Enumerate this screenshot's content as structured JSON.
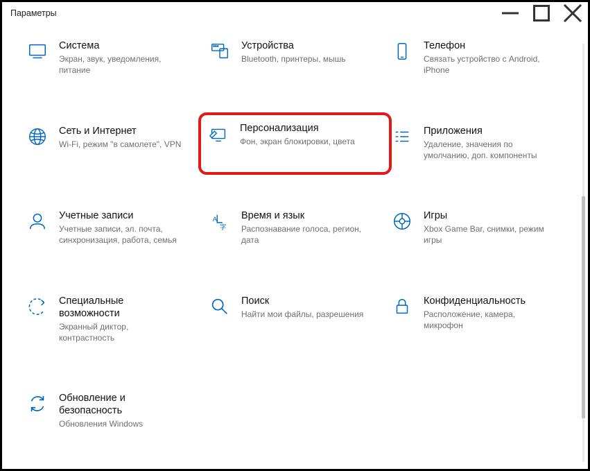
{
  "window": {
    "title": "Параметры"
  },
  "items": [
    {
      "title": "Система",
      "desc": "Экран, звук, уведомления, питание"
    },
    {
      "title": "Устройства",
      "desc": "Bluetooth, принтеры, мышь"
    },
    {
      "title": "Телефон",
      "desc": "Связать устройство с Android, iPhone"
    },
    {
      "title": "Сеть и Интернет",
      "desc": "Wi-Fi, режим \"в самолете\", VPN"
    },
    {
      "title": "Персонализация",
      "desc": "Фон, экран блокировки, цвета"
    },
    {
      "title": "Приложения",
      "desc": "Удаление, значения по умолчанию, доп. компоненты"
    },
    {
      "title": "Учетные записи",
      "desc": "Учетные записи, эл. почта, синхронизация, работа, семья"
    },
    {
      "title": "Время и язык",
      "desc": "Распознавание голоса, регион, дата"
    },
    {
      "title": "Игры",
      "desc": "Xbox Game Bar, снимки, режим игры"
    },
    {
      "title": "Специальные возможности",
      "desc": "Экранный диктор, контрастность"
    },
    {
      "title": "Поиск",
      "desc": "Найти мои файлы, разрешения"
    },
    {
      "title": "Конфиденциальность",
      "desc": "Расположение, камера, микрофон"
    },
    {
      "title": "Обновление и безопасность",
      "desc": "Обновления Windows"
    }
  ]
}
